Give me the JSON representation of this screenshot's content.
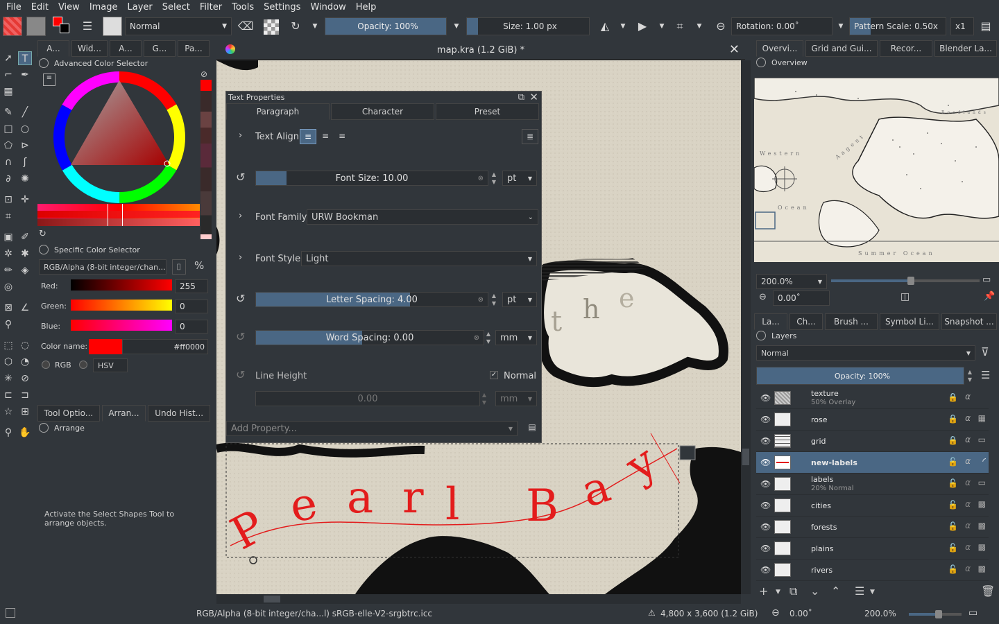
{
  "menu": [
    "File",
    "Edit",
    "View",
    "Image",
    "Layer",
    "Select",
    "Filter",
    "Tools",
    "Settings",
    "Window",
    "Help"
  ],
  "toolbar": {
    "blend_mode": "Normal",
    "opacity": "Opacity: 100%",
    "size": "Size: 1.00 px",
    "rotation": "Rotation: 0.00˚",
    "pattern_scale": "Pattern Scale: 0.50x",
    "multiplier": "x1"
  },
  "left_tabs": [
    "A...",
    "Wid...",
    "A...",
    "G...",
    "Pa..."
  ],
  "advanced_color_selector": {
    "title": "Advanced Color Selector"
  },
  "specific_color_selector": {
    "title": "Specific Color Selector",
    "model": "RGB/Alpha (8-bit integer/chan...",
    "red_label": "Red:",
    "red": "255",
    "green_label": "Green:",
    "green": "0",
    "blue_label": "Blue:",
    "blue": "0",
    "color_name_label": "Color name:",
    "hex": "#ff0000",
    "rgb_label": "RGB",
    "hsv_label": "HSV"
  },
  "bottom_tabs": [
    "Tool Optio...",
    "Arran...",
    "Undo Hist..."
  ],
  "arrange": {
    "title": "Arrange",
    "hint": "Activate the Select Shapes Tool to arrange objects."
  },
  "document": {
    "title": "map.kra (1.2 GiB) *"
  },
  "canvas": {
    "words": [
      "t",
      "h",
      "e"
    ],
    "label_letters": [
      "P",
      "e",
      "a",
      "r",
      "l",
      "B",
      "a",
      "y"
    ]
  },
  "text_properties": {
    "title": "Text Properties",
    "tabs": [
      "Paragraph",
      "Character",
      "Preset"
    ],
    "text_align": "Text Align",
    "font_size": "Font Size: 10.00",
    "font_size_unit": "pt",
    "font_family_label": "Font Family",
    "font_family": "URW Bookman",
    "font_style_label": "Font Style",
    "font_style": "Light",
    "letter_spacing": "Letter Spacing: 4.00",
    "letter_spacing_unit": "pt",
    "word_spacing": "Word Spacing: 0.00",
    "word_spacing_unit": "mm",
    "line_height_label": "Line Height",
    "line_height_normal": "Normal",
    "line_height_value": "0.00",
    "line_height_unit": "mm",
    "add_property": "Add Property..."
  },
  "right_tabs_top": [
    "Overvi...",
    "Grid and Gui...",
    "Recor...",
    "Blender La..."
  ],
  "overview": {
    "title": "Overview",
    "zoom": "200.0%",
    "rotation": "0.00˚",
    "map_labels": [
      "Western",
      "Ocean",
      "Summer Ocean",
      "Roadlands",
      "Aagent"
    ]
  },
  "right_tabs_bottom": [
    "La...",
    "Ch...",
    "Brush ...",
    "Symbol Li...",
    "Snapshot ..."
  ],
  "layers": {
    "title": "Layers",
    "blend_mode": "Normal",
    "opacity": "Opacity: 100%",
    "items": [
      {
        "name": "texture",
        "sub": "50% Overlay"
      },
      {
        "name": "rose",
        "sub": ""
      },
      {
        "name": "grid",
        "sub": ""
      },
      {
        "name": "new-labels",
        "sub": ""
      },
      {
        "name": "labels",
        "sub": "20% Normal"
      },
      {
        "name": "cities",
        "sub": ""
      },
      {
        "name": "forests",
        "sub": ""
      },
      {
        "name": "plains",
        "sub": ""
      },
      {
        "name": "rivers",
        "sub": ""
      }
    ]
  },
  "status": {
    "color_space": "RGB/Alpha (8-bit integer/cha...l)  sRGB-elle-V2-srgbtrc.icc",
    "dimensions": "4,800 x 3,600 (1.2 GiB)",
    "rotation": "0.00˚",
    "zoom": "200.0%"
  },
  "colors": {
    "accent": "#4a6784",
    "foreground": "#ff0000",
    "text_path": "#e31c1c"
  }
}
